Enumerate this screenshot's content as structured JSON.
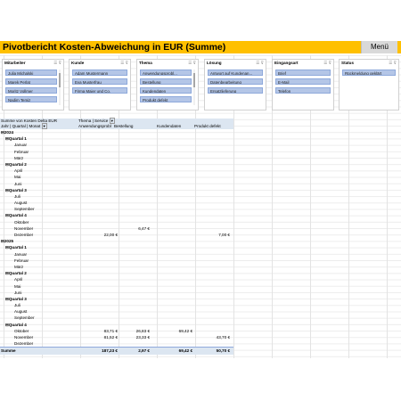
{
  "title": "Pivotbericht Kosten-Abweichung in EUR (Summe)",
  "menu_label": "Menü",
  "slicers": [
    {
      "header": "Mitarbeiter",
      "items": [
        "Julia Michalski",
        "Marek Perlat",
        "Moritz Vollmer",
        "Nadim Temiz"
      ]
    },
    {
      "header": "Kunde",
      "items": [
        "Adam Mustermann",
        "Eva Musterfrau",
        "Firma Maier und Co."
      ]
    },
    {
      "header": "Thema",
      "items": [
        "Anwendungsprobl...",
        "Bestellung",
        "Kundendaten",
        "Produkt defekt"
      ]
    },
    {
      "header": "Lösung",
      "items": [
        "Antwort auf Kundenan...",
        "Datenbearbeitung",
        "Ersatzlieferung"
      ]
    },
    {
      "header": "Eingangsart",
      "items": [
        "Brief",
        "E-Mail",
        "Telefon"
      ]
    },
    {
      "header": "Status",
      "items": [
        "Rückmeldung geklärt"
      ]
    }
  ],
  "pivot": {
    "corner_label": "Summe von Kosten Delta EUR",
    "col_field": "Thema | Service",
    "row_field": "Jahr | Quartal | Monat",
    "columns": [
      "Anwendungsprobl",
      "Bestellung",
      "Kundendaten",
      "Produkt defekt"
    ],
    "rows": [
      {
        "level": "year",
        "label": "⊟2024",
        "vals": [
          "",
          "",
          "",
          ""
        ]
      },
      {
        "level": "q",
        "label": "⊟Quartal 1",
        "vals": [
          "",
          "",
          "",
          ""
        ]
      },
      {
        "level": "m",
        "label": "Januar",
        "vals": [
          "",
          "",
          "",
          ""
        ]
      },
      {
        "level": "m",
        "label": "Februar",
        "vals": [
          "",
          "",
          "",
          ""
        ]
      },
      {
        "level": "m",
        "label": "März",
        "vals": [
          "",
          "",
          "",
          ""
        ]
      },
      {
        "level": "q",
        "label": "⊟Quartal 2",
        "vals": [
          "",
          "",
          "",
          ""
        ]
      },
      {
        "level": "m",
        "label": "April",
        "vals": [
          "",
          "",
          "",
          ""
        ]
      },
      {
        "level": "m",
        "label": "Mai",
        "vals": [
          "",
          "",
          "",
          ""
        ]
      },
      {
        "level": "m",
        "label": "Juni",
        "vals": [
          "",
          "",
          "",
          ""
        ]
      },
      {
        "level": "q",
        "label": "⊟Quartal 3",
        "vals": [
          "",
          "",
          "",
          ""
        ]
      },
      {
        "level": "m",
        "label": "Juli",
        "vals": [
          "",
          "",
          "",
          ""
        ]
      },
      {
        "level": "m",
        "label": "August",
        "vals": [
          "",
          "",
          "",
          ""
        ]
      },
      {
        "level": "m",
        "label": "September",
        "vals": [
          "",
          "",
          "",
          ""
        ]
      },
      {
        "level": "q",
        "label": "⊟Quartal 4",
        "vals": [
          "",
          "",
          "",
          ""
        ]
      },
      {
        "level": "m",
        "label": "Oktober",
        "vals": [
          "",
          "",
          "",
          ""
        ]
      },
      {
        "level": "m",
        "label": "November",
        "vals": [
          "",
          "6,47 €",
          "",
          ""
        ]
      },
      {
        "level": "m",
        "label": "Dezember",
        "vals": [
          "22,00 €",
          "",
          "",
          "7,00 €"
        ]
      },
      {
        "level": "year",
        "label": "⊟2025",
        "vals": [
          "",
          "",
          "",
          ""
        ]
      },
      {
        "level": "q",
        "label": "⊟Quartal 1",
        "vals": [
          "",
          "",
          "",
          ""
        ]
      },
      {
        "level": "m",
        "label": "Januar",
        "vals": [
          "",
          "",
          "",
          ""
        ]
      },
      {
        "level": "m",
        "label": "Februar",
        "vals": [
          "",
          "",
          "",
          ""
        ]
      },
      {
        "level": "m",
        "label": "März",
        "vals": [
          "",
          "",
          "",
          ""
        ]
      },
      {
        "level": "q",
        "label": "⊟Quartal 2",
        "vals": [
          "",
          "",
          "",
          ""
        ]
      },
      {
        "level": "m",
        "label": "April",
        "vals": [
          "",
          "",
          "",
          ""
        ]
      },
      {
        "level": "m",
        "label": "Mai",
        "vals": [
          "",
          "",
          "",
          ""
        ]
      },
      {
        "level": "m",
        "label": "Juni",
        "vals": [
          "",
          "",
          "",
          ""
        ]
      },
      {
        "level": "q",
        "label": "⊟Quartal 3",
        "vals": [
          "",
          "",
          "",
          ""
        ]
      },
      {
        "level": "m",
        "label": "Juli",
        "vals": [
          "",
          "",
          "",
          ""
        ]
      },
      {
        "level": "m",
        "label": "August",
        "vals": [
          "",
          "",
          "",
          ""
        ]
      },
      {
        "level": "m",
        "label": "September",
        "vals": [
          "",
          "",
          "",
          ""
        ]
      },
      {
        "level": "q",
        "label": "⊟Quartal 4",
        "vals": [
          "",
          "",
          "",
          ""
        ]
      },
      {
        "level": "m",
        "label": "Oktober",
        "vals": [
          "83,71 €",
          "26,83 €",
          "69,42 €",
          ""
        ]
      },
      {
        "level": "m",
        "label": "November",
        "vals": [
          "81,52 €",
          "23,33 €",
          "",
          "43,70 €"
        ]
      },
      {
        "level": "m",
        "label": "Dezember",
        "vals": [
          "",
          "",
          "",
          ""
        ]
      }
    ],
    "total": {
      "label": "Summe",
      "vals": [
        "187,23 €",
        "2,97 €",
        "69,42 €",
        "50,70 €"
      ]
    }
  }
}
